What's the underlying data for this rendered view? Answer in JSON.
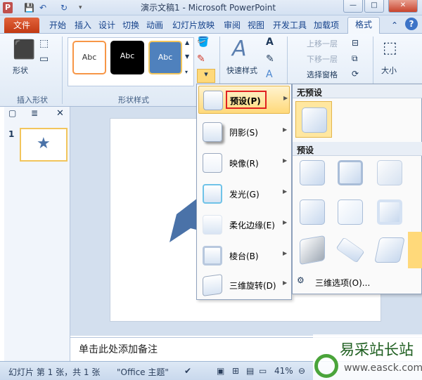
{
  "window": {
    "title": "演示文稿1 - Microsoft PowerPoint",
    "app_icon": "P",
    "controls": [
      "—",
      "□",
      "✕"
    ]
  },
  "tabs": {
    "file": "文件",
    "items": [
      "开始",
      "插入",
      "设计",
      "切换",
      "动画",
      "幻灯片放映",
      "审阅",
      "视图",
      "开发工具",
      "加载项"
    ],
    "active": "格式"
  },
  "ribbon": {
    "insert_shapes": {
      "button_label": "形状",
      "group_label": "插入形状"
    },
    "shape_styles": {
      "swatch_text": "Abc",
      "group_label": "形状样式"
    },
    "wordart": {
      "button_label": "快速样式"
    },
    "arrange": {
      "bring_forward": "上移一层",
      "send_backward": "下移一层",
      "selection_pane": "选择窗格"
    },
    "size": {
      "button_label": "大小"
    }
  },
  "slides_pane": {
    "slide_number": "1",
    "thumb_symbol": "★"
  },
  "notes": {
    "placeholder": "单击此处添加备注"
  },
  "statusbar": {
    "slide_info": "幻灯片 第 1 张，共 1 张",
    "theme": "\"Office 主题\"",
    "zoom": "41%"
  },
  "effects_menu": {
    "items": [
      {
        "label": "预设(P)",
        "highlighted": true
      },
      {
        "label": "阴影(S)"
      },
      {
        "label": "映像(R)"
      },
      {
        "label": "发光(G)"
      },
      {
        "label": "柔化边缘(E)"
      },
      {
        "label": "棱台(B)"
      },
      {
        "label": "三维旋转(D)"
      }
    ]
  },
  "preset_submenu": {
    "no_preset_header": "无预设",
    "preset_header": "预设",
    "options_label": "三维选项(O)..."
  },
  "watermark": {
    "brand": "易采站长站",
    "url": "www.easck.com"
  },
  "colors": {
    "accent_file": "#c23a14",
    "highlight": "#ffd97a",
    "star": "#4a72a8"
  }
}
